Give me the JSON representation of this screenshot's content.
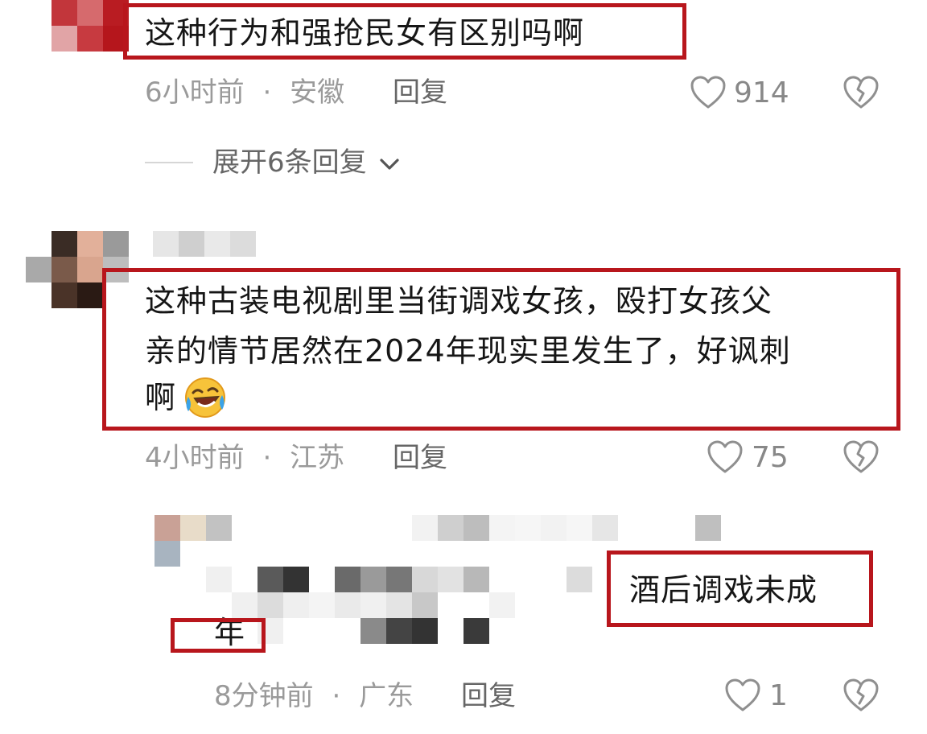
{
  "comments": [
    {
      "text_lines": [
        "这种行为和强抢民女有区别吗啊"
      ],
      "time": "6小时前",
      "location": "安徽",
      "reply_label": "回复",
      "likes": "914",
      "expand_label": "展开6条回复"
    },
    {
      "text_lines": [
        "这种古装电视剧里当街调戏女孩，殴打女孩父",
        "亲的情节居然在2024年现实里发生了，好讽刺",
        "啊"
      ],
      "time": "4小时前",
      "location": "江苏",
      "reply_label": "回复",
      "likes": "75"
    },
    {
      "text_fragment_1": "酒后调戏未成",
      "text_fragment_2": "年",
      "time": "8分钟前",
      "location": "广东",
      "reply_label": "回复",
      "likes": "1"
    }
  ],
  "meta_separator": "·",
  "icons": {
    "like": "heart-outline-icon",
    "dislike": "broken-heart-icon",
    "expand": "chevron-down-icon",
    "emoji": "laughing-crying-emoji"
  },
  "colors": {
    "highlight_box": "#b8161c",
    "text": "#161616",
    "meta": "#9a9a9a"
  }
}
